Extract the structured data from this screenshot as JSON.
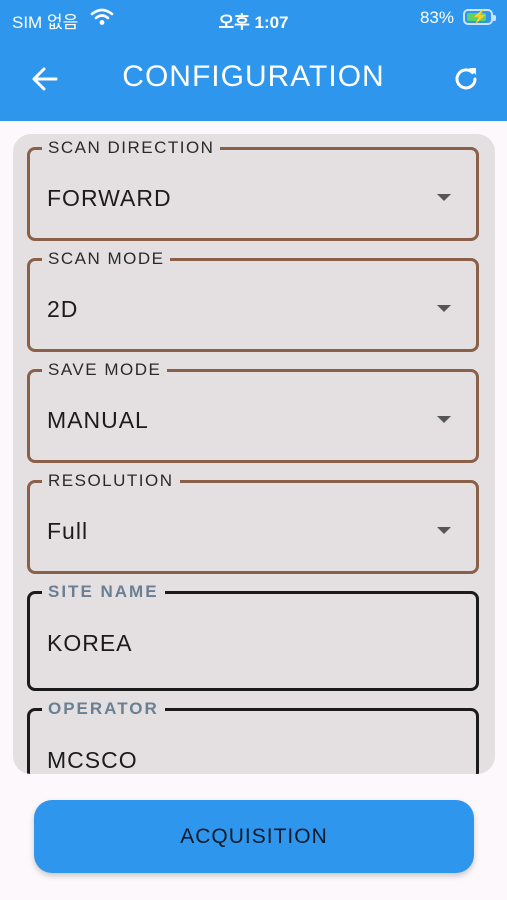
{
  "status_bar": {
    "carrier": "SIM 없음",
    "time": "오후 1:07",
    "battery": "83%"
  },
  "header": {
    "title": "CONFIGURATION",
    "back_icon": "arrow-left-icon",
    "refresh_icon": "refresh-icon"
  },
  "fields": {
    "scan_direction": {
      "label": "SCAN DIRECTION",
      "value": "FORWARD"
    },
    "scan_mode": {
      "label": "SCAN MODE",
      "value": "2D"
    },
    "save_mode": {
      "label": "SAVE MODE",
      "value": "MANUAL"
    },
    "resolution": {
      "label": "RESOLUTION",
      "value": "Full"
    },
    "site_name": {
      "label": "SITE NAME",
      "value": "KOREA"
    },
    "operator": {
      "label": "OPERATOR",
      "value": "MCSCO"
    }
  },
  "footer": {
    "acquisition_label": "ACQUISITION"
  },
  "colors": {
    "primary": "#2f96ee",
    "dropdown_border": "#8a6049",
    "text_field_border": "#1b1b1b",
    "card_bg": "#e4e0e1"
  }
}
